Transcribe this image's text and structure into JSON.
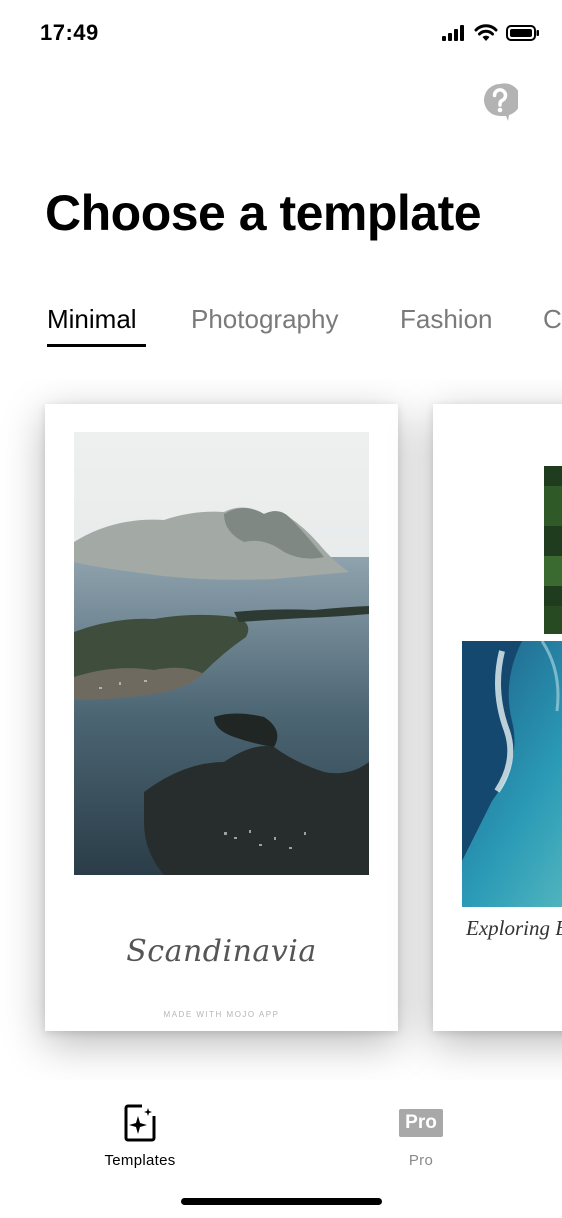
{
  "status_bar": {
    "time": "17:49"
  },
  "header": {
    "title": "Choose a template"
  },
  "tabs": [
    {
      "label": "Minimal",
      "active": true
    },
    {
      "label": "Photography",
      "active": false
    },
    {
      "label": "Fashion",
      "active": false
    },
    {
      "label": "C",
      "active": false
    }
  ],
  "templates": [
    {
      "caption": "Scandinavia",
      "watermark": "MADE WITH MOJO APP"
    },
    {
      "caption": "Exploring Bi"
    }
  ],
  "bottom_nav": {
    "templates_label": "Templates",
    "pro_label": "Pro",
    "pro_badge": "Pro"
  },
  "icons": {
    "help": "help-icon",
    "templates": "templates-icon",
    "pro": "pro-icon"
  },
  "colors": {
    "active_text": "#000000",
    "inactive_text": "#7a7a7a",
    "pro_badge_bg": "#a8a8a8"
  }
}
